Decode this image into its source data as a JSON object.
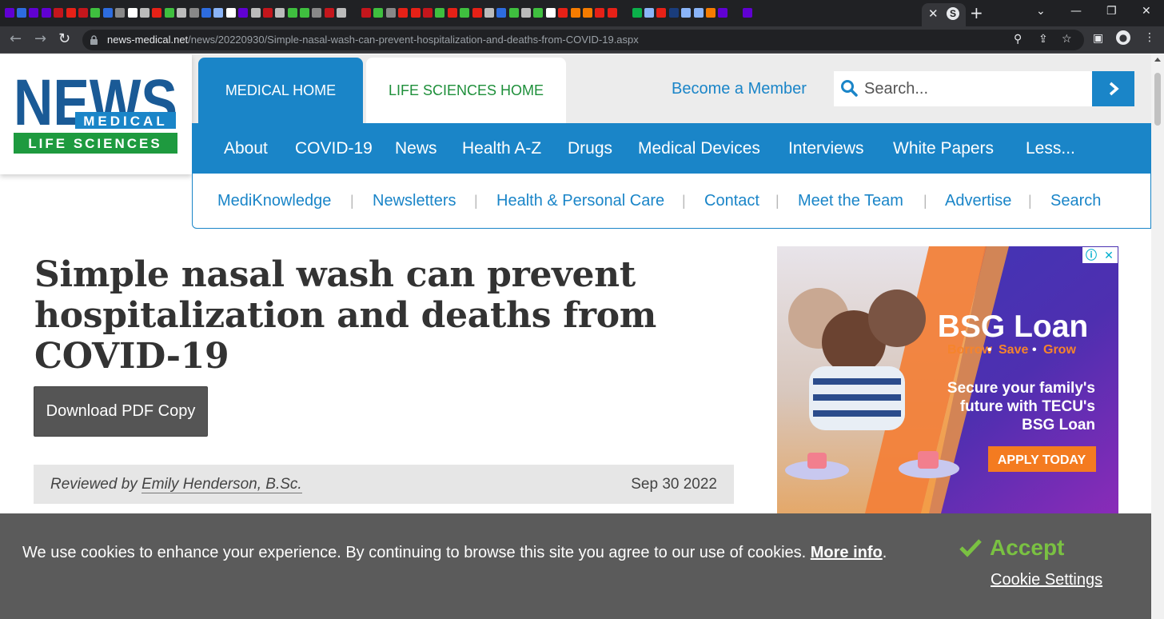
{
  "browser": {
    "tab_favicon_colors": [
      "#6001d2",
      "#2d6cdf",
      "#6001d2",
      "#6001d2",
      "#c4161c",
      "#e62117",
      "#c4161c",
      "#3fbf3f",
      "#2d6cdf",
      "#888888",
      "#ffffff",
      "#bbbbbb",
      "#e62117",
      "#3fbf3f",
      "#bbbbbb",
      "#888888",
      "#2d6cdf",
      "#8ab4f8",
      "#ffffff",
      "#6001d2",
      "#bbbbbb",
      "#c4161c",
      "#bbbbbb",
      "#3fbf3f",
      "#3fbf3f",
      "#888888",
      "#c4161c",
      "#bbbbbb",
      "#202124",
      "#c4161c",
      "#3fbf3f",
      "#888888",
      "#e62117",
      "#e62117",
      "#c4161c",
      "#3fbf3f",
      "#e62117",
      "#3fbf3f",
      "#e62117",
      "#bbbbbb",
      "#2d6cdf",
      "#3fbf3f",
      "#bbbbbb",
      "#3fbf3f",
      "#ffffff",
      "#e62117",
      "#f57c00",
      "#f57c00",
      "#e62117",
      "#e62117",
      "#202124",
      "#0bb04a",
      "#8ab4f8",
      "#e62117",
      "#1a3d7c",
      "#8ab4f8",
      "#8ab4f8",
      "#f57c00",
      "#6001d2",
      "#202124",
      "#6001d2"
    ],
    "active_tab_favicon": "S",
    "url_host": "news-medical.net",
    "url_path": "/news/20220930/Simple-nasal-wash-can-prevent-hospitalization-and-deaths-from-COVID-19.aspx",
    "icons": [
      "close-icon",
      "new-tab-icon",
      "back-icon",
      "forward-icon",
      "reload-icon",
      "lock-icon",
      "zoom-icon",
      "share-icon",
      "star-icon",
      "side-panel-icon",
      "profile-icon",
      "menu-icon"
    ]
  },
  "site": {
    "brand_color": "#1a85c8",
    "green_color": "#1e8f3a",
    "logo": {
      "word": "NEWS",
      "line2": "MEDICAL",
      "line3": "LIFE SCIENCES"
    },
    "top_tabs": {
      "medical": "MEDICAL HOME",
      "life": "LIFE SCIENCES HOME"
    },
    "become_member": "Become a Member",
    "search_placeholder": "Search...",
    "main_nav": [
      "About",
      "COVID-19",
      "News",
      "Health A-Z",
      "Drugs",
      "Medical Devices",
      "Interviews",
      "White Papers",
      "Less..."
    ],
    "sub_nav": [
      "MediKnowledge",
      "Newsletters",
      "Health & Personal Care",
      "Contact",
      "Meet the Team",
      "Advertise",
      "Search"
    ]
  },
  "article": {
    "title": "Simple nasal wash can prevent hospitalization and deaths from COVID-19",
    "pdf_button": "Download PDF Copy",
    "reviewed_prefix": "Reviewed by",
    "reviewer": "Emily Henderson, B.Sc.",
    "date": "Sep 30 2022"
  },
  "ad": {
    "headline": "BSG Loan",
    "tag1": "Borrow",
    "tag2": "Save",
    "tag3": "Grow",
    "body_line1": "Secure your family's",
    "body_line2": "future with TECU's",
    "body_line3": "BSG Loan",
    "cta": "APPLY TODAY"
  },
  "cookie": {
    "message": "We use cookies to enhance your experience. By continuing to browse this site you agree to our use of cookies.",
    "more_info": "More info",
    "accept": "Accept",
    "settings": "Cookie Settings",
    "accept_color": "#7ac142"
  }
}
